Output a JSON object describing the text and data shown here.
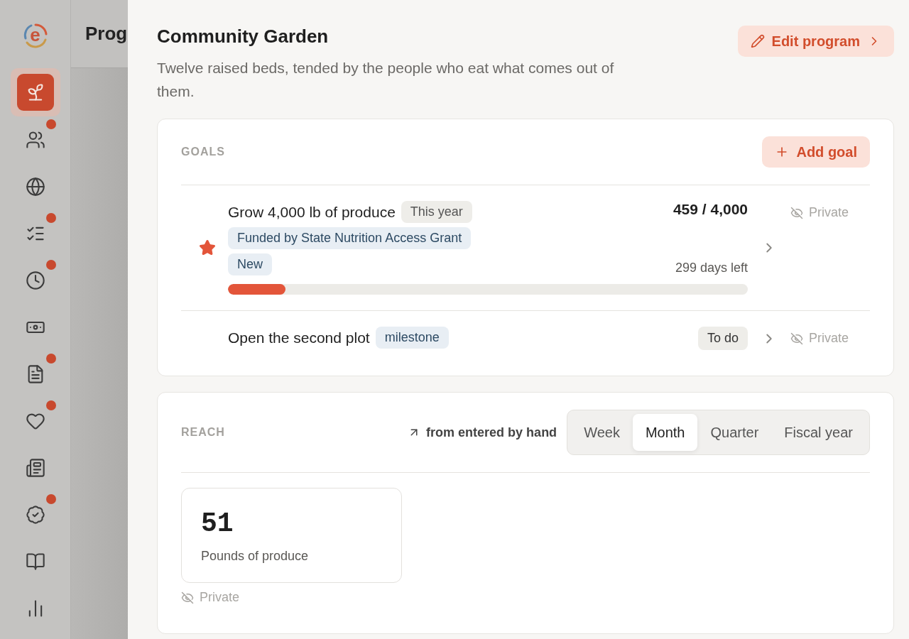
{
  "logo": {
    "letter": "e"
  },
  "sidebar": {
    "items": [
      {
        "selected": true,
        "badge": false
      },
      {
        "selected": false,
        "badge": true
      },
      {
        "selected": false,
        "badge": false
      },
      {
        "selected": false,
        "badge": true
      },
      {
        "selected": false,
        "badge": true
      },
      {
        "selected": false,
        "badge": false
      },
      {
        "selected": false,
        "badge": true
      },
      {
        "selected": false,
        "badge": true
      },
      {
        "selected": false,
        "badge": false
      },
      {
        "selected": false,
        "badge": true
      },
      {
        "selected": false,
        "badge": false
      },
      {
        "selected": false,
        "badge": false
      }
    ]
  },
  "background_page": {
    "title": "Prog"
  },
  "drawer": {
    "title": "Community Garden",
    "description": "Twelve raised beds, tended by the people who eat what comes out of them.",
    "edit_button": "Edit program"
  },
  "goals": {
    "heading": "GOALS",
    "add_button": "Add goal",
    "items": [
      {
        "title": "Grow 4,000 lb of produce",
        "starred": true,
        "tags": [
          {
            "label": "This year",
            "kind": "period"
          },
          {
            "label": "Funded by State Nutrition Access Grant",
            "kind": "info"
          },
          {
            "label": "New",
            "kind": "info"
          }
        ],
        "value": "459 / 4,000",
        "remaining": "299 days left",
        "level": 0.11,
        "visibility": "Private"
      },
      {
        "title": "Open the second plot",
        "starred": false,
        "tags": [
          {
            "label": "milestone",
            "kind": "info"
          }
        ],
        "status": "To do",
        "visibility": "Private"
      }
    ]
  },
  "reach": {
    "heading": "REACH",
    "source": "from entered by hand",
    "periods": [
      {
        "label": "Week",
        "selected": false
      },
      {
        "label": "Month",
        "selected": true
      },
      {
        "label": "Quarter",
        "selected": false
      },
      {
        "label": "Fiscal year",
        "selected": false
      }
    ],
    "metrics": [
      {
        "value": "51",
        "label": "Pounds of produce",
        "visibility": "Private"
      }
    ]
  }
}
